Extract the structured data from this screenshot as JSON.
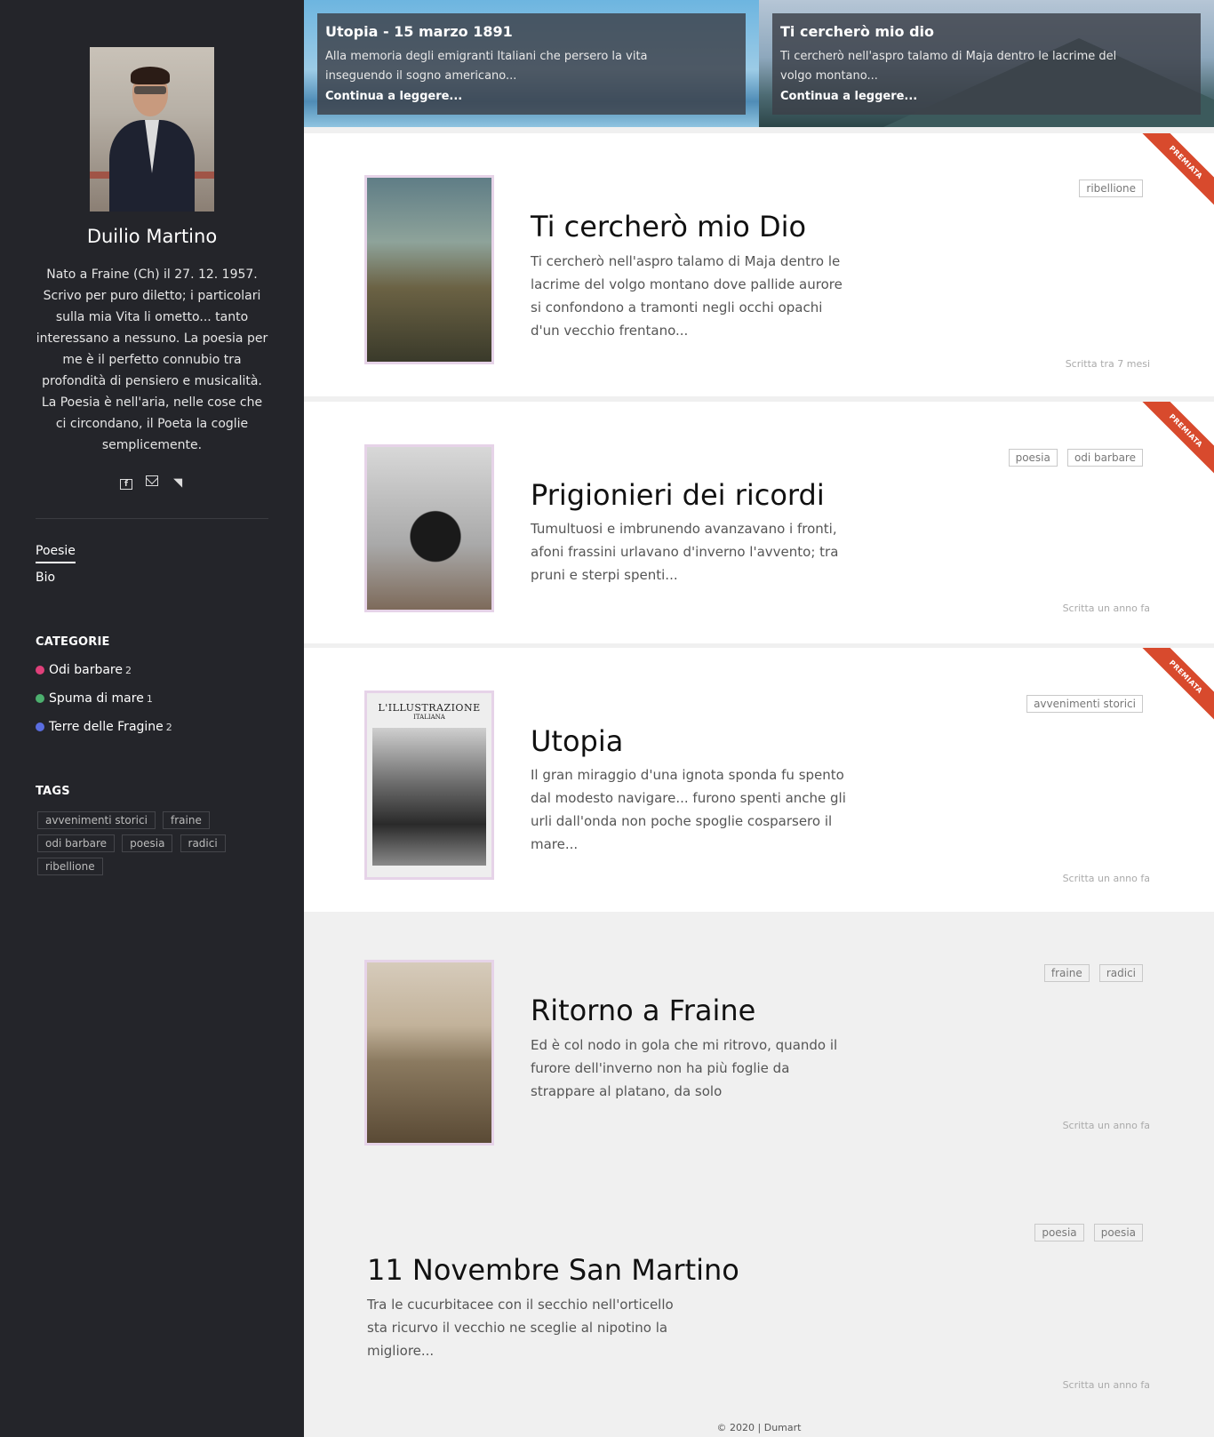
{
  "author": {
    "name": "Duilio Martino",
    "bio": "Nato a Fraine (Ch) il 27. 12. 1957. Scrivo per puro diletto; i particolari sulla mia Vita li ometto... tanto interessano a nessuno. La poesia per me è il perfetto connubio tra profondità di pensiero e musicalità. La Poesia è nell'aria, nelle cose che ci circondano, il Poeta la coglie semplicemente."
  },
  "social": {
    "facebook": "f",
    "rss": "◥"
  },
  "nav": [
    {
      "label": "Poesie",
      "active": true
    },
    {
      "label": "Bio",
      "active": false
    }
  ],
  "categories_heading": "CATEGORIE",
  "categories": [
    {
      "label": "Odi barbare",
      "count": "2",
      "color": "#e0407a"
    },
    {
      "label": "Spuma di mare",
      "count": "1",
      "color": "#4caf6e"
    },
    {
      "label": "Terre delle Fragine",
      "count": "2",
      "color": "#5a6de0"
    }
  ],
  "tags_heading": "TAGS",
  "tags": [
    "avvenimenti storici",
    "fraine",
    "odi barbare",
    "poesia",
    "radici",
    "ribellione"
  ],
  "featured": [
    {
      "title": "Utopia - 15 marzo 1891",
      "text": "Alla memoria degli emigranti Italiani che persero la vita inseguendo il sogno americano...",
      "link": "Continua a leggere..."
    },
    {
      "title": "Ti cercherò mio dio",
      "text": "Ti cercherò nell'aspro talamo di Maja dentro le lacrime del volgo montano...",
      "link": "Continua a leggere..."
    }
  ],
  "posts": [
    {
      "title": "Ti cercherò mio Dio",
      "excerpt": "Ti cercherò nell'aspro talamo di Maja dentro le lacrime del volgo montano dove pallide aurore si confondono a tramonti negli occhi opachi d'un vecchio frentano...",
      "tags": [
        "ribellione"
      ],
      "date": "Scritta tra 7 mesi",
      "ribbon": "PREMIATA"
    },
    {
      "title": "Prigionieri dei ricordi",
      "excerpt": "Tumultuosi e imbrunendo avanzavano i fronti, afoni frassini urlavano d'inverno l'avvento; tra pruni e sterpi spenti...",
      "tags": [
        "poesia",
        "odi barbare"
      ],
      "date": "Scritta un anno fa",
      "ribbon": "PREMIATA"
    },
    {
      "title": "Utopia",
      "excerpt": "Il gran miraggio d'una ignota sponda fu spento dal modesto navigare... furono spenti anche gli urli dall'onda non poche spoglie cosparsero il mare...",
      "tags": [
        "avvenimenti storici"
      ],
      "date": "Scritta un anno fa",
      "ribbon": "PREMIATA",
      "thumb_masthead": "L'ILLUSTRAZIONE",
      "thumb_subhead": "ITALIANA"
    },
    {
      "title": "Ritorno a Fraine",
      "excerpt": "Ed è col nodo in gola che mi ritrovo, quando il furore dell'inverno non ha più foglie da strappare al platano, da solo",
      "tags": [
        "fraine",
        "radici"
      ],
      "date": "Scritta un anno fa"
    },
    {
      "title": "11 Novembre San Martino",
      "excerpt": "Tra le cucurbitacee con il secchio nell'orticello sta ricurvo il vecchio ne sceglie al nipotino la migliore...",
      "tags": [
        "poesia",
        "poesia"
      ],
      "date": "Scritta un anno fa"
    }
  ],
  "footer": "© 2020 | Dumart"
}
